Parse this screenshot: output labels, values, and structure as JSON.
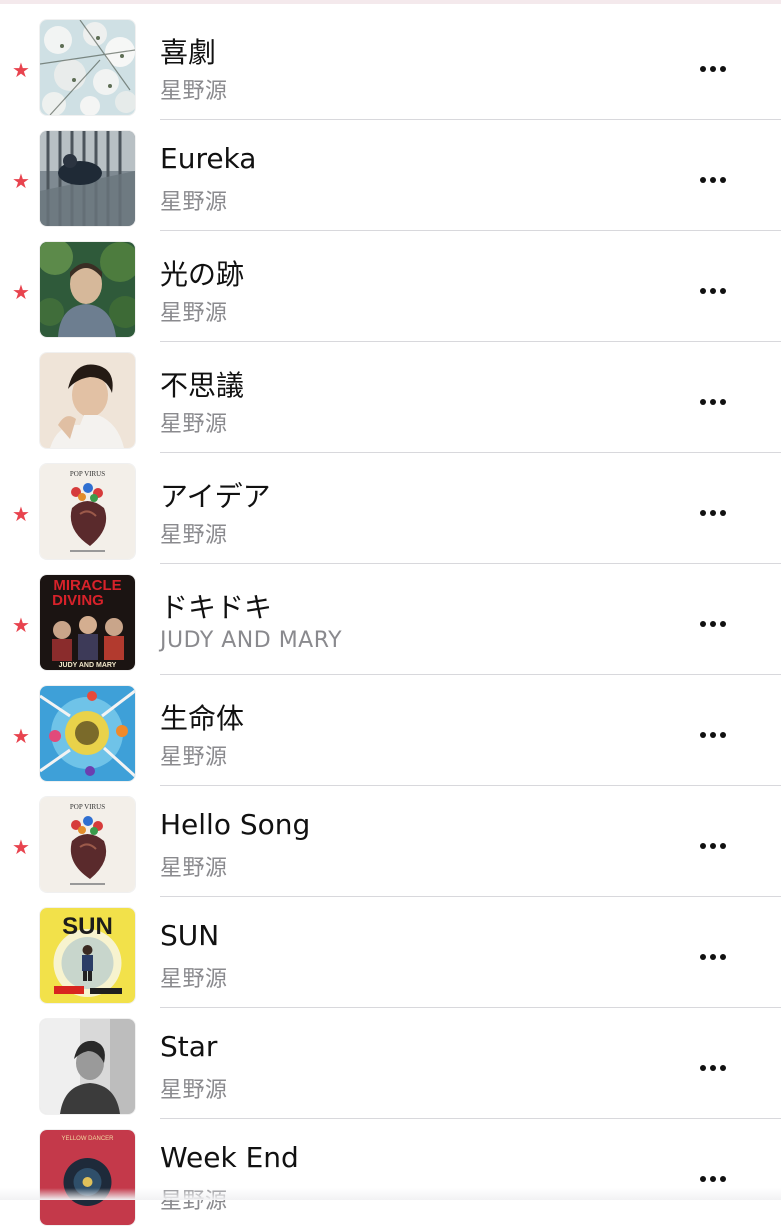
{
  "accent_color": "#e8434e",
  "songs": [
    {
      "title": "喜劇",
      "artist": "星野源",
      "favorite": true,
      "art": "blossom"
    },
    {
      "title": "Eureka",
      "artist": "星野源",
      "favorite": true,
      "art": "eureka"
    },
    {
      "title": "光の跡",
      "artist": "星野源",
      "favorite": true,
      "art": "green-portrait"
    },
    {
      "title": "不思議",
      "artist": "星野源",
      "favorite": false,
      "art": "portrait"
    },
    {
      "title": "アイデア",
      "artist": "星野源",
      "favorite": true,
      "art": "pop-virus"
    },
    {
      "title": "ドキドキ",
      "artist": "JUDY AND MARY",
      "favorite": true,
      "art": "miracle-diving"
    },
    {
      "title": "生命体",
      "artist": "星野源",
      "favorite": true,
      "art": "splash"
    },
    {
      "title": "Hello Song",
      "artist": "星野源",
      "favorite": true,
      "art": "pop-virus"
    },
    {
      "title": "SUN",
      "artist": "星野源",
      "favorite": false,
      "art": "sun"
    },
    {
      "title": "Star",
      "artist": "星野源",
      "favorite": false,
      "art": "bw-portrait"
    },
    {
      "title": "Week End",
      "artist": "星野源",
      "favorite": false,
      "art": "yellow-dancer"
    }
  ],
  "art_text": {
    "pop_virus": "POP VIRUS",
    "miracle_line1": "MIRACLE",
    "miracle_line2": "DIVING",
    "miracle_footer": "JUDY AND MARY",
    "sun": "SUN",
    "yellow_dancer": "YELLOW DANCER"
  },
  "icons": {
    "favorite": "star-icon",
    "more": "more-options-icon"
  }
}
